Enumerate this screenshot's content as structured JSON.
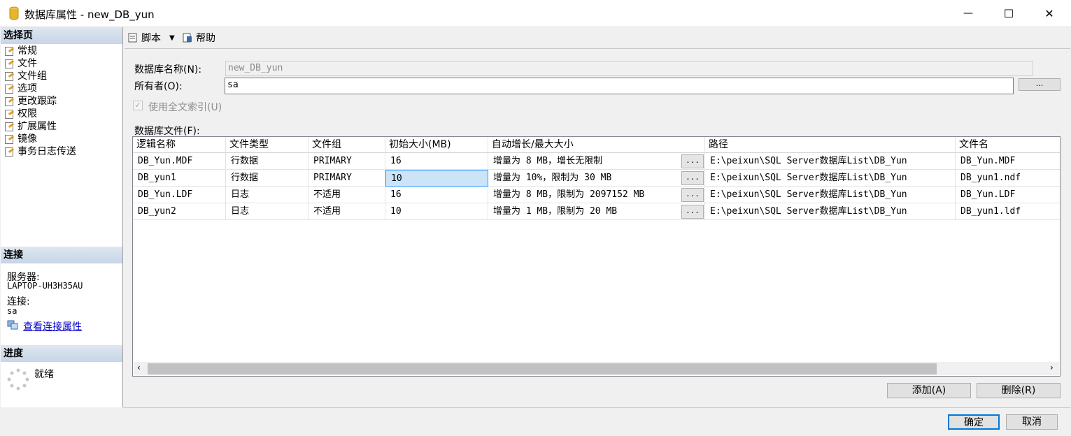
{
  "window": {
    "title": "数据库属性 - new_DB_yun",
    "minimize_glyph": "—",
    "maximize_glyph": "☐",
    "close_glyph": "✕"
  },
  "left_panel": {
    "select_page_header": "选择页",
    "pages": [
      "常规",
      "文件",
      "文件组",
      "选项",
      "更改跟踪",
      "权限",
      "扩展属性",
      "镜像",
      "事务日志传送"
    ],
    "connection_header": "连接",
    "server_label": "服务器:",
    "server_value": "LAPTOP-UH3H35AU",
    "connection_label": "连接:",
    "connection_value": "sa",
    "view_conn_props_link": "查看连接属性",
    "progress_header": "进度",
    "progress_status": "就绪"
  },
  "toolbar": {
    "script_label": "脚本",
    "help_label": "帮助"
  },
  "form": {
    "db_name_label": "数据库名称(N):",
    "db_name_value": "new_DB_yun",
    "owner_label": "所有者(O):",
    "owner_value": "sa",
    "owner_browse": "...",
    "fulltext_label": "使用全文索引(U)",
    "files_label": "数据库文件(F):"
  },
  "files_table": {
    "headers": [
      "逻辑名称",
      "文件类型",
      "文件组",
      "初始大小(MB)",
      "自动增长/最大大小",
      "路径",
      "文件名"
    ],
    "rows": [
      {
        "logical_name": "DB_Yun.MDF",
        "file_type": "行数据",
        "filegroup": "PRIMARY",
        "initial_size": "16",
        "autogrowth": "增量为 8 MB，增长无限制",
        "path": "E:\\peixun\\SQL Server数据库List\\DB_Yun",
        "file_name": "DB_Yun.MDF"
      },
      {
        "logical_name": "DB_yun1",
        "file_type": "行数据",
        "filegroup": "PRIMARY",
        "initial_size": "10",
        "autogrowth": "增量为 10%，限制为 30 MB",
        "path": "E:\\peixun\\SQL Server数据库List\\DB_Yun",
        "file_name": "DB_yun1.ndf"
      },
      {
        "logical_name": "DB_Yun.LDF",
        "file_type": "日志",
        "filegroup": "不适用",
        "initial_size": "16",
        "autogrowth": "增量为 8 MB，限制为 2097152 MB",
        "path": "E:\\peixun\\SQL Server数据库List\\DB_Yun",
        "file_name": "DB_Yun.LDF"
      },
      {
        "logical_name": "DB_yun2",
        "file_type": "日志",
        "filegroup": "不适用",
        "initial_size": "10",
        "autogrowth": "增量为 1 MB，限制为 20 MB",
        "path": "E:\\peixun\\SQL Server数据库List\\DB_Yun",
        "file_name": "DB_yun1.ldf"
      }
    ],
    "ellipsis": "...",
    "selected_cell": {
      "row": 1,
      "column": "initial_size"
    }
  },
  "actions": {
    "add_label": "添加(A)",
    "remove_label": "删除(R)",
    "ok_label": "确定",
    "cancel_label": "取消"
  },
  "colors": {
    "header_gradient_top": "#dfe7f1",
    "header_gradient_bottom": "#c7d5e7",
    "selected_cell": "#cce4f7",
    "link": "#0000cc",
    "ok_border": "#0078d7"
  }
}
